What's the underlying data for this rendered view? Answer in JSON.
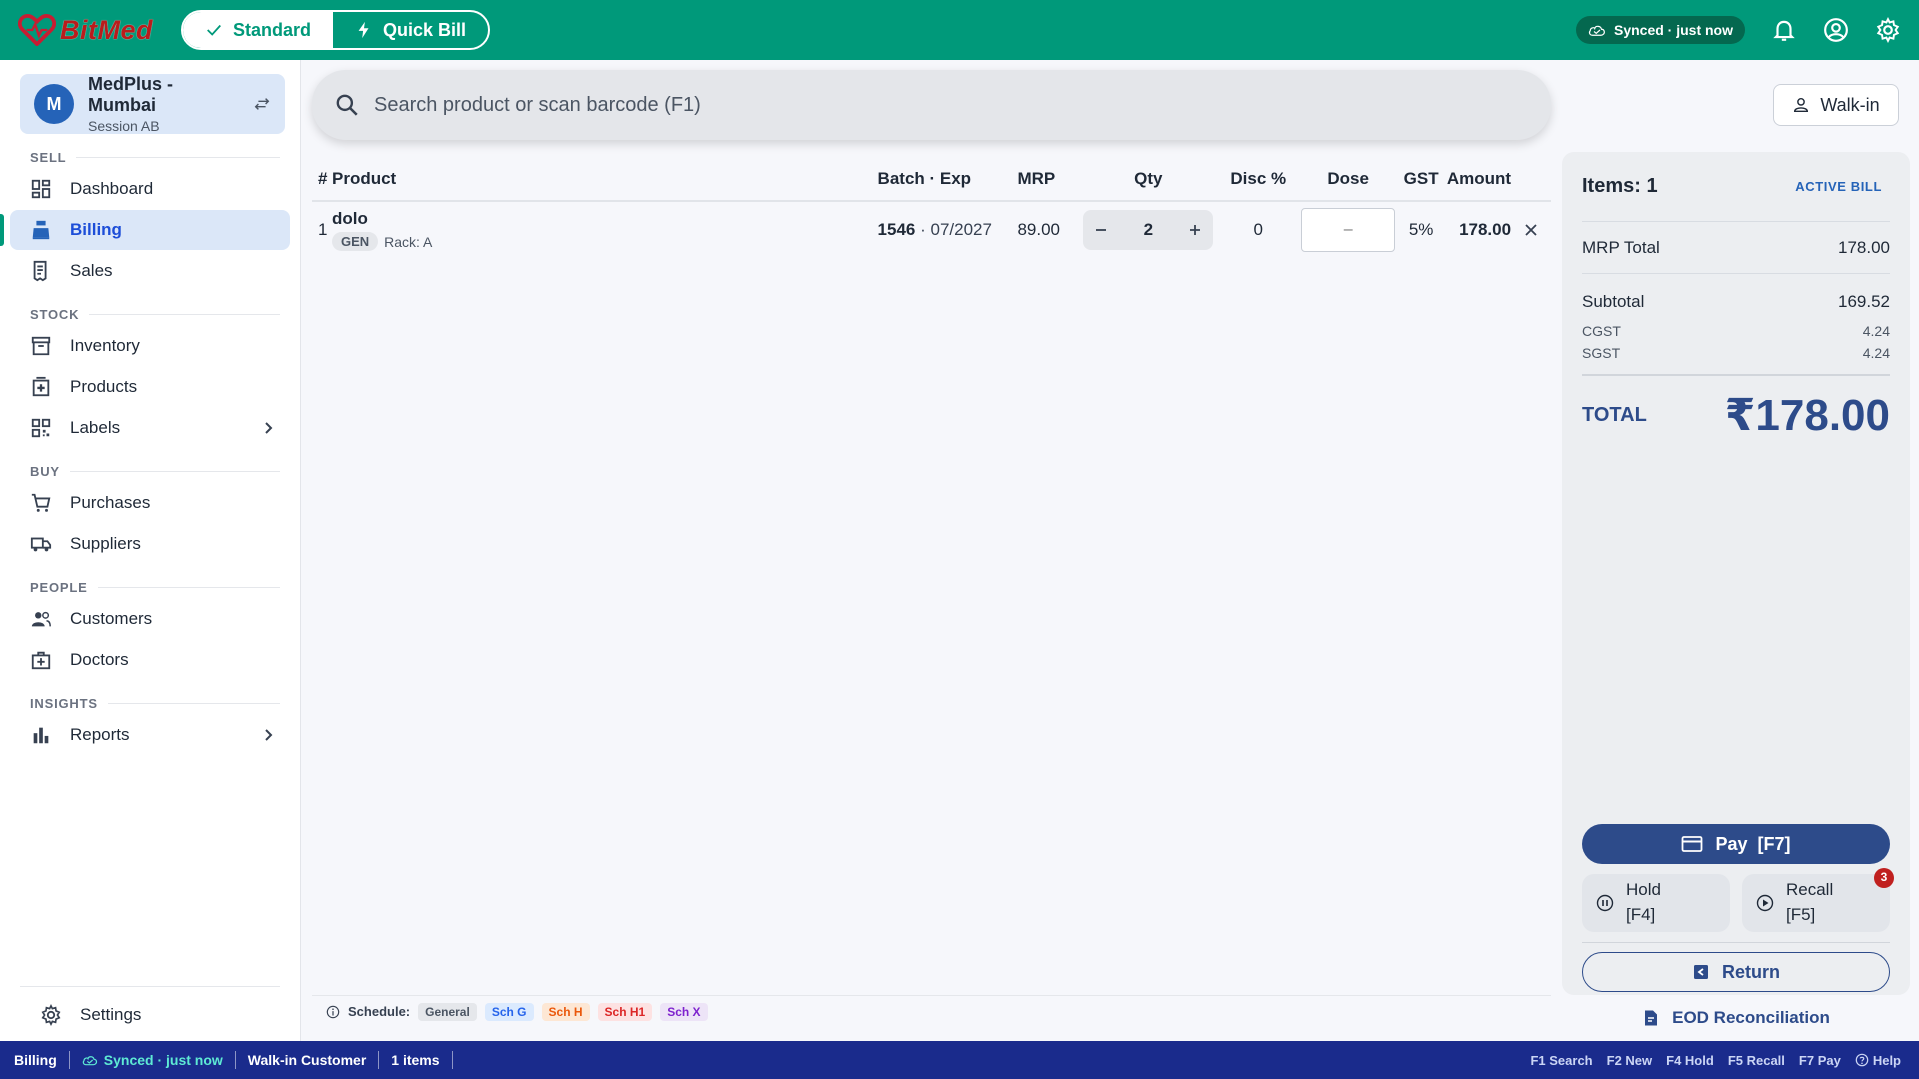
{
  "app": {
    "brand": "BitMed"
  },
  "modes": [
    {
      "label": "Standard",
      "icon": "check-icon",
      "active": true
    },
    {
      "label": "Quick Bill",
      "icon": "bolt-icon",
      "active": false
    }
  ],
  "topbar": {
    "sync_status": "Synced · just now"
  },
  "store": {
    "avatar_letter": "M",
    "name": "MedPlus - Mumbai",
    "session": "Session AB"
  },
  "nav": {
    "sections": {
      "sell": "SELL",
      "stock": "STOCK",
      "buy": "BUY",
      "people": "PEOPLE",
      "insights": "INSIGHTS"
    },
    "items": {
      "dashboard": "Dashboard",
      "billing": "Billing",
      "sales": "Sales",
      "inventory": "Inventory",
      "products": "Products",
      "labels": "Labels",
      "purchases": "Purchases",
      "suppliers": "Suppliers",
      "customers": "Customers",
      "doctors": "Doctors",
      "reports": "Reports",
      "settings": "Settings"
    },
    "active": "billing"
  },
  "search": {
    "placeholder": "Search product or scan barcode (F1)"
  },
  "customer_button": {
    "label": "Walk-in"
  },
  "table": {
    "headers": {
      "no": "#",
      "product": "Product",
      "batch": "Batch · Exp",
      "mrp": "MRP",
      "qty": "Qty",
      "disc": "Disc %",
      "dose": "Dose",
      "gst": "GST",
      "amount": "Amount"
    },
    "rows": [
      {
        "no": "1",
        "product": "dolo",
        "tag": "GEN",
        "rack": "Rack: A",
        "batch": "1546",
        "sep": "·",
        "exp": "07/2027",
        "mrp": "89.00",
        "qty": "2",
        "disc": "0",
        "dose_placeholder": "–",
        "gst": "5%",
        "amount": "178.00"
      }
    ]
  },
  "schedule": {
    "label": "Schedule:",
    "chips": [
      {
        "label": "General",
        "bg": "#e5e7eb",
        "fg": "#4b5563"
      },
      {
        "label": "Sch G",
        "bg": "#dbeafe",
        "fg": "#2563eb"
      },
      {
        "label": "Sch H",
        "bg": "#fde7d4",
        "fg": "#ea580c"
      },
      {
        "label": "Sch H1",
        "bg": "#fde2e2",
        "fg": "#dc2626"
      },
      {
        "label": "Sch X",
        "bg": "#ede4f7",
        "fg": "#7e22ce"
      }
    ]
  },
  "summary": {
    "items_label": "Items: 1",
    "active_bill": "ACTIVE BILL",
    "mrp_total_label": "MRP Total",
    "mrp_total": "178.00",
    "subtotal_label": "Subtotal",
    "subtotal": "169.52",
    "cgst_label": "CGST",
    "cgst": "4.24",
    "sgst_label": "SGST",
    "sgst": "4.24",
    "total_label": "TOTAL",
    "total": "₹178.00"
  },
  "actions": {
    "pay": "Pay  [F7]",
    "hold_line1": "Hold",
    "hold_line2": "[F4]",
    "recall_line1": "Recall",
    "recall_line2": "[F5]",
    "recall_badge": "3",
    "return": "Return",
    "eod": "EOD Reconciliation"
  },
  "statusbar": {
    "page": "Billing",
    "sync": "Synced · just now",
    "customer": "Walk-in Customer",
    "items": "1 items",
    "shortcuts": [
      "F1 Search",
      "F2 New",
      "F4 Hold",
      "F5 Recall",
      "F7 Pay"
    ],
    "help": "Help"
  },
  "colors": {
    "topbar": "#00997a",
    "primary": "#2d4b8a",
    "statusbar": "#1a2b8c",
    "active_nav_bg": "#dbe7f8",
    "badge": "#c0201f"
  }
}
